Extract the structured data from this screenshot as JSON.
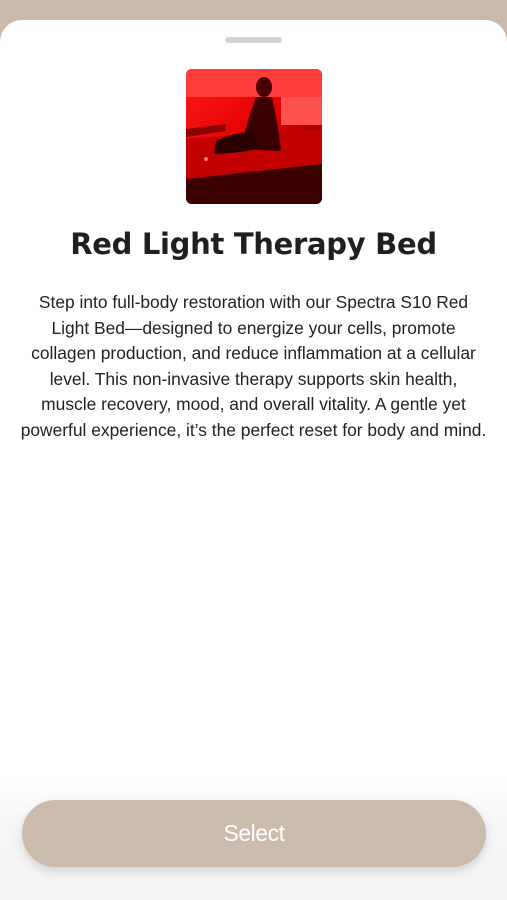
{
  "product": {
    "image_icon": "red-light-bed-photo",
    "title": "Red Light Therapy Bed",
    "description": "Step into full-body restoration with our Spectra S10 Red Light Bed—designed to energize your cells, promote collagen production, and reduce inflammation at a cellular level. This non-invasive therapy supports skin health, muscle recovery, mood, and overall vitality. A gentle yet powerful experience, it’s the perfect reset for body and mind."
  },
  "actions": {
    "select_label": "Select"
  },
  "colors": {
    "accent": "#cbbbad",
    "backdrop": "#c9b9ab",
    "sheet": "#ffffff",
    "title": "#1f1f1f"
  }
}
